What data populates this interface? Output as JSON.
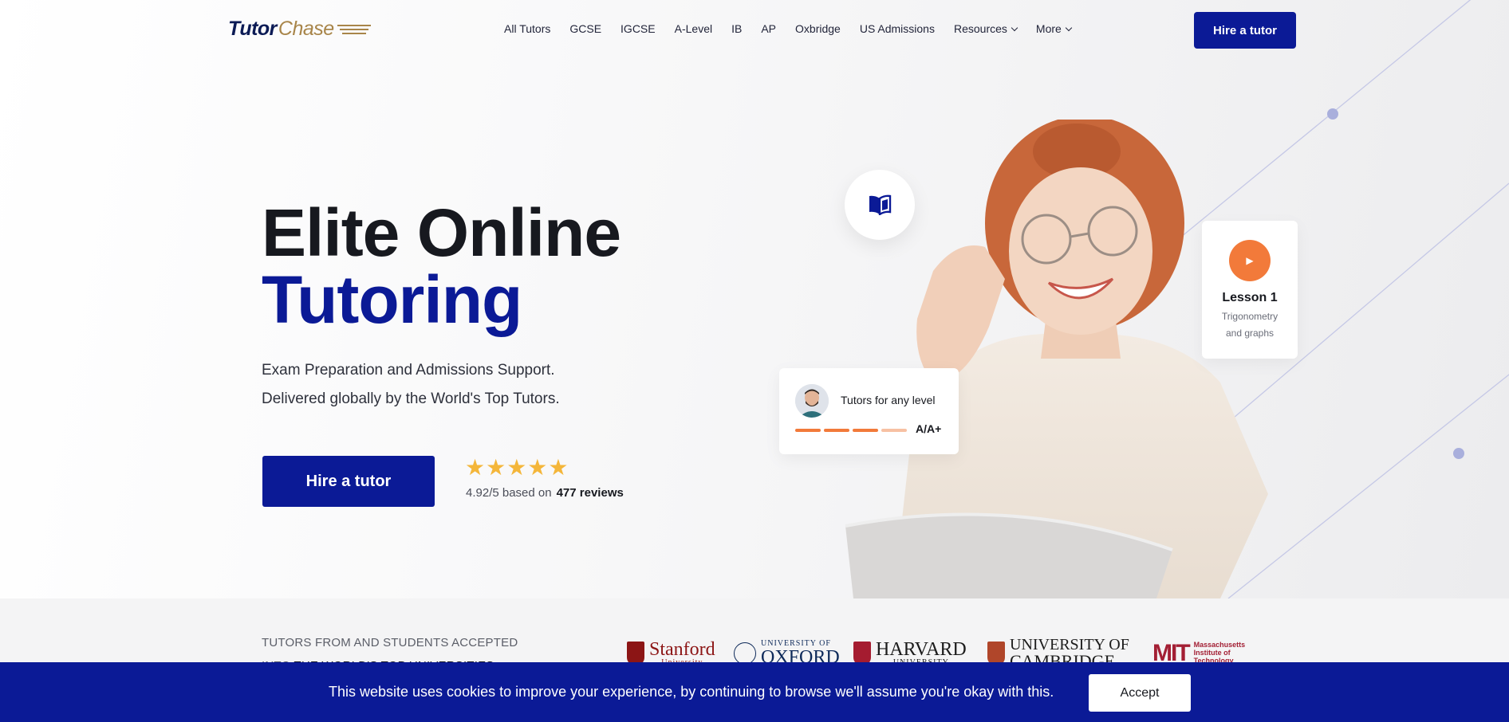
{
  "header": {
    "logo_part1": "Tutor",
    "logo_part2": "Chase",
    "nav": [
      "All Tutors",
      "GCSE",
      "IGCSE",
      "A-Level",
      "IB",
      "AP",
      "Oxbridge",
      "US Admissions",
      "Resources",
      "More"
    ],
    "cta_label": "Hire a tutor"
  },
  "hero": {
    "title_line1": "Elite Online",
    "title_line2": "Tutoring",
    "subtitle_line1": "Exam Preparation and Admissions Support.",
    "subtitle_line2": "Delivered globally by the World's Top Tutors.",
    "cta_label": "Hire a tutor",
    "stars": "★★★★★",
    "star_rating": 5,
    "rating_text": "4.92/5 based on",
    "reviews_text": "477 reviews"
  },
  "cards": {
    "lesson_title": "Lesson 1",
    "lesson_subtitle": "Trigonometry and graphs",
    "tutor_text": "Tutors for any level",
    "grade": "A/A+",
    "level_progress": 0.75
  },
  "universities": {
    "text_line1": "TUTORS FROM AND STUDENTS ACCEPTED",
    "text_line2_prefix": "INTO",
    "text_line2_bold": "THE WORLD'S TOP UNIVERSITIES",
    "items": [
      {
        "top": "",
        "name": "Stanford",
        "sub": "University",
        "color": "#8c1515"
      },
      {
        "top": "UNIVERSITY OF",
        "name": "OXFORD",
        "sub": "",
        "color": "#0e2a5a"
      },
      {
        "top": "",
        "name": "HARVARD",
        "sub": "UNIVERSITY",
        "color": "#1c1c1c"
      },
      {
        "top": "UNIVERSITY OF",
        "name": "CAMBRIDGE",
        "sub": "",
        "color": "#1c1c1c"
      },
      {
        "top": "Massachusetts",
        "name": "Institute of",
        "sub": "Technology",
        "color": "#a31f34"
      }
    ]
  },
  "cookie": {
    "message": "This website uses cookies to improve your experience, by continuing to browse we'll assume you're okay with this.",
    "accept_label": "Accept"
  },
  "colors": {
    "brand_blue": "#0b1a96",
    "accent_orange": "#f27a3a",
    "star_gold": "#f4b63a",
    "logo_gold": "#a88549"
  }
}
